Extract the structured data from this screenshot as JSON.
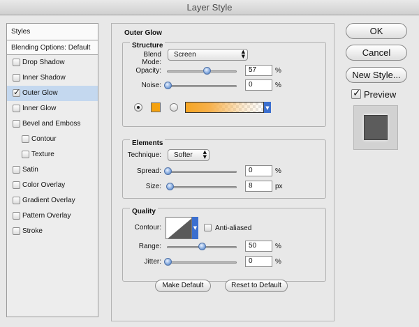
{
  "window": {
    "title": "Layer Style"
  },
  "sidebar": {
    "header": "Styles",
    "blending_options": "Blending Options: Default",
    "items": [
      {
        "label": "Drop Shadow",
        "checked": false,
        "indent": false,
        "selected": false
      },
      {
        "label": "Inner Shadow",
        "checked": false,
        "indent": false,
        "selected": false
      },
      {
        "label": "Outer Glow",
        "checked": true,
        "indent": false,
        "selected": true
      },
      {
        "label": "Inner Glow",
        "checked": false,
        "indent": false,
        "selected": false
      },
      {
        "label": "Bevel and Emboss",
        "checked": false,
        "indent": false,
        "selected": false
      },
      {
        "label": "Contour",
        "checked": false,
        "indent": true,
        "selected": false
      },
      {
        "label": "Texture",
        "checked": false,
        "indent": true,
        "selected": false
      },
      {
        "label": "Satin",
        "checked": false,
        "indent": false,
        "selected": false
      },
      {
        "label": "Color Overlay",
        "checked": false,
        "indent": false,
        "selected": false
      },
      {
        "label": "Gradient Overlay",
        "checked": false,
        "indent": false,
        "selected": false
      },
      {
        "label": "Pattern Overlay",
        "checked": false,
        "indent": false,
        "selected": false
      },
      {
        "label": "Stroke",
        "checked": false,
        "indent": false,
        "selected": false
      }
    ]
  },
  "panel": {
    "title": "Outer Glow",
    "structure": {
      "title": "Structure",
      "blend_mode_label": "Blend Mode:",
      "blend_mode_value": "Screen",
      "opacity_label": "Opacity:",
      "opacity_value": "57",
      "opacity_level": 0.57,
      "opacity_unit": "%",
      "noise_label": "Noise:",
      "noise_value": "0",
      "noise_level": 0,
      "noise_unit": "%",
      "glow_color": "#f5a20f",
      "color_mode": "solid"
    },
    "elements": {
      "title": "Elements",
      "technique_label": "Technique:",
      "technique_value": "Softer",
      "spread_label": "Spread:",
      "spread_value": "0",
      "spread_level": 0,
      "spread_unit": "%",
      "size_label": "Size:",
      "size_value": "8",
      "size_level": 0.032,
      "size_unit": "px"
    },
    "quality": {
      "title": "Quality",
      "contour_label": "Contour:",
      "anti_aliased_label": "Anti-aliased",
      "anti_aliased": false,
      "range_label": "Range:",
      "range_value": "50",
      "range_level": 0.5,
      "range_unit": "%",
      "jitter_label": "Jitter:",
      "jitter_value": "0",
      "jitter_level": 0,
      "jitter_unit": "%"
    },
    "make_default_label": "Make Default",
    "reset_default_label": "Reset to Default"
  },
  "buttons": {
    "ok_label": "OK",
    "cancel_label": "Cancel",
    "new_style_label": "New Style...",
    "preview_label": "Preview",
    "preview_checked": true
  }
}
